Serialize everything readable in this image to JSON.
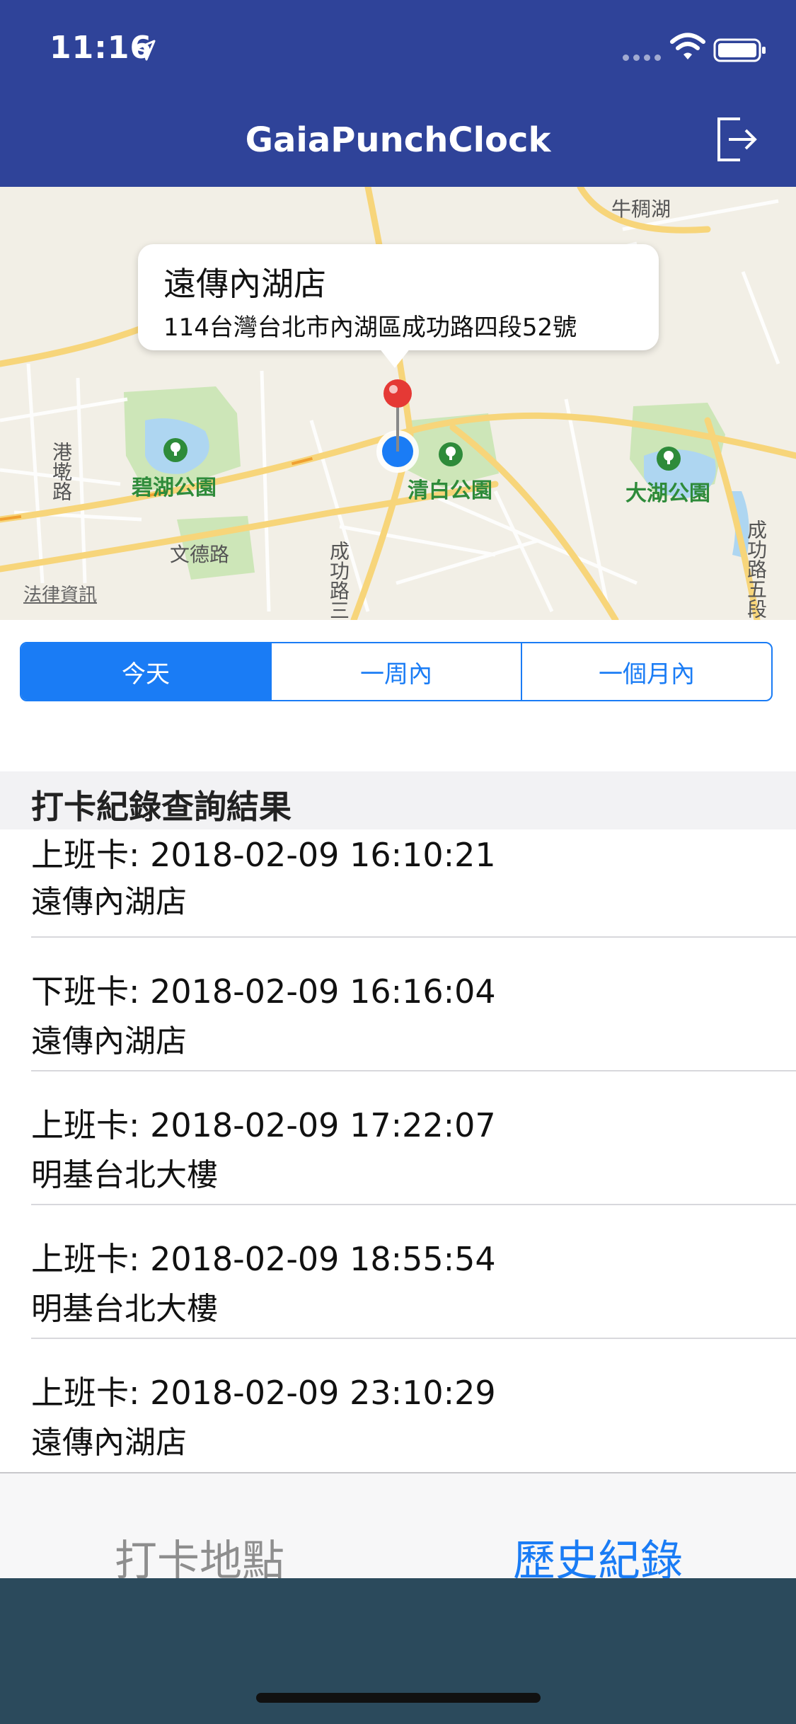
{
  "status": {
    "time": "11:16"
  },
  "nav": {
    "title": "GaiaPunchClock",
    "logout_icon": "logout-icon"
  },
  "map": {
    "callout_title": "遠傳內湖店",
    "callout_address": "114台灣台北市內湖區成功路四段52號",
    "labels": {
      "top_right": "牛稠湖",
      "park_bihu": "碧湖公園",
      "park_qingbai": "清白公園",
      "park_dahu": "大湖公園",
      "road_wende": "文德路",
      "road_chenggong3": "成功路三",
      "road_chenggong5": "成功路五段",
      "road_left": "港墘路"
    },
    "legal": "法律資訊",
    "pin_color": "#e53935",
    "user_dot_color": "#1a7cf5"
  },
  "segmented": {
    "segments": [
      "今天",
      "一周內",
      "一個月內"
    ],
    "selected_index": 0
  },
  "records": {
    "header": "打卡紀錄查詢結果",
    "rows": [
      {
        "line1": "上班卡: 2018-02-09 16:10:21",
        "line2": "遠傳內湖店"
      },
      {
        "line1": "下班卡: 2018-02-09 16:16:04",
        "line2": "遠傳內湖店"
      },
      {
        "line1": "上班卡: 2018-02-09 17:22:07",
        "line2": "明基台北大樓"
      },
      {
        "line1": "上班卡: 2018-02-09 18:55:54",
        "line2": "明基台北大樓"
      },
      {
        "line1": "上班卡: 2018-02-09 23:10:29",
        "line2": "遠傳內湖店"
      }
    ]
  },
  "tabbar": {
    "left": "打卡地點",
    "right": "歷史紀錄",
    "selected": "right"
  },
  "colors": {
    "nav_bg": "#2f4399",
    "accent": "#1a7cf5",
    "bottom_band": "#2b4a5c"
  }
}
